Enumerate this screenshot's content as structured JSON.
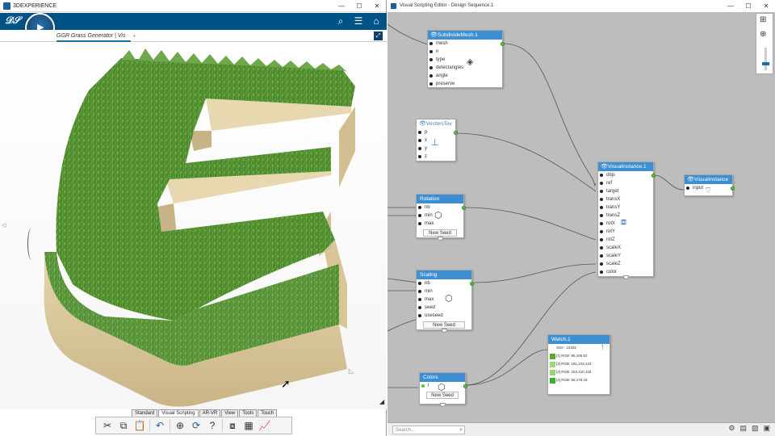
{
  "left_window": {
    "title": "3DEXPERIENCE",
    "compass_version": "R",
    "tab_label": "GGR Grass Generator | Vis",
    "tab_add": "+",
    "bottom_tabs": [
      "Standard",
      "Visual Scripting",
      "AR-VR",
      "View",
      "Tools",
      "Touch"
    ],
    "active_tab": "Visual Scripting"
  },
  "right_window": {
    "title": "Visual Scripting Editor - Design Sequence.1",
    "search_placeholder": "Search..."
  },
  "nodes": {
    "subdivide": {
      "title": "SubdivideMesh.1",
      "ports": [
        "mesh",
        "n",
        "type",
        "detectangles",
        "angle",
        "preserve"
      ]
    },
    "vectors": {
      "title": "VectorsTov",
      "ports": [
        "p",
        "x",
        "y",
        "z"
      ]
    },
    "rotation": {
      "title": "Rotation",
      "ports": [
        "nb",
        "min",
        "max"
      ],
      "button": "New Seed"
    },
    "scaling": {
      "title": "Scaling",
      "ports": [
        "nb",
        "min",
        "max",
        "seed",
        "useseed"
      ],
      "button": "New Seed"
    },
    "colors": {
      "title": "Colors",
      "ports": [
        "l"
      ],
      "button": "New Seed"
    },
    "visual_instance": {
      "title": "VisualInstance.1",
      "ports": [
        "objs",
        "ref",
        "target",
        "transX",
        "transY",
        "transZ",
        "rotX",
        "rotY",
        "rotZ",
        "scaleX",
        "scaleY",
        "scaleZ",
        "color"
      ]
    },
    "visual_instance2": {
      "title": "VisualInstance",
      "ports": [
        "input"
      ]
    },
    "watch": {
      "title": "Watch.1",
      "size_label": "Size : 15331",
      "rows": [
        {
          "label": "[1] RGB: 95,165,52",
          "color": "#5fa534"
        },
        {
          "label": "[2] RGB: 161,215,124",
          "color": "#a1d77c"
        },
        {
          "label": "[3] RGB: 153,210,118",
          "color": "#99d276"
        },
        {
          "label": "[4] RGB: 55,176,43",
          "color": "#37b02b"
        }
      ]
    }
  }
}
